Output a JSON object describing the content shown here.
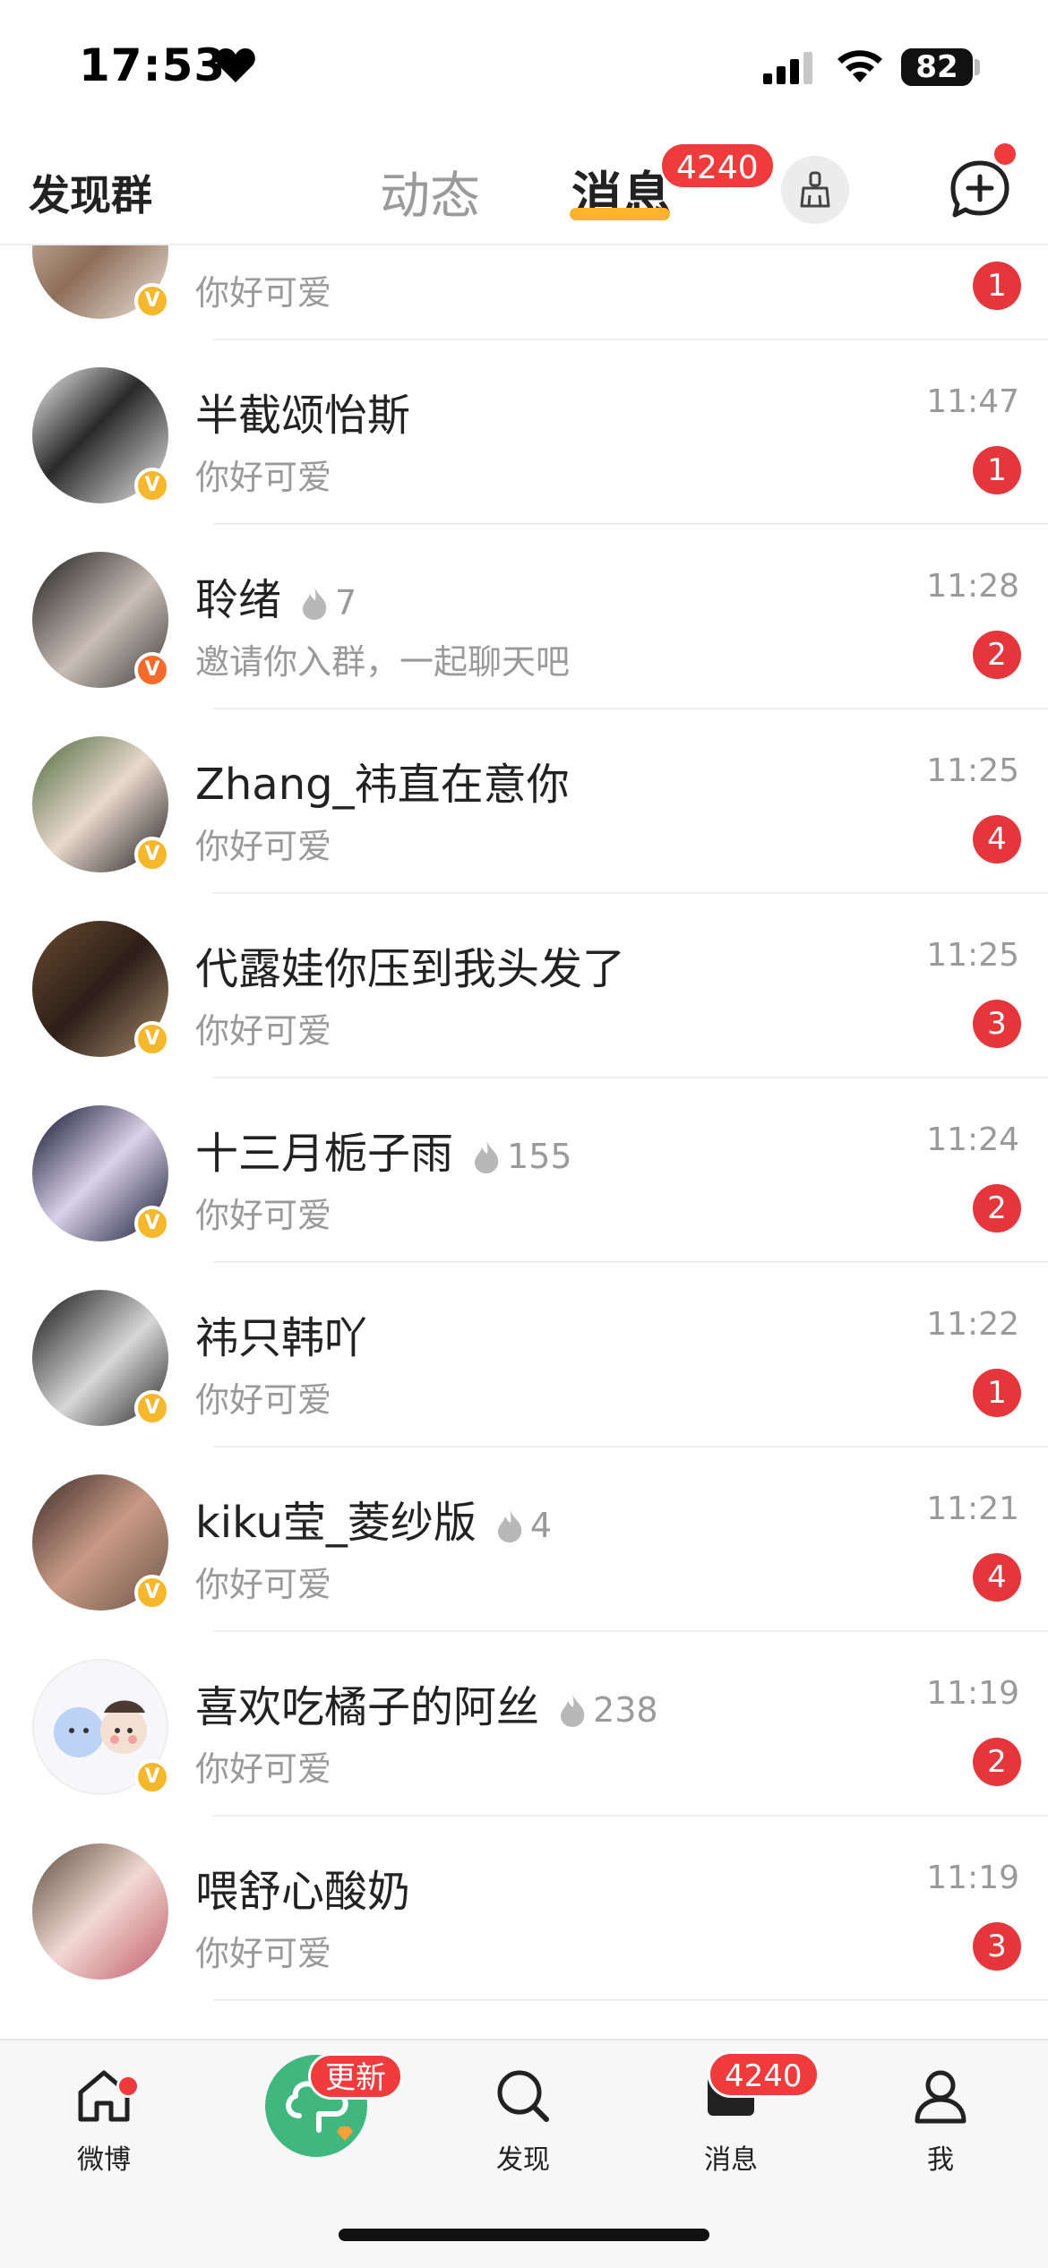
{
  "status_bar": {
    "time": "17:53",
    "battery": "82"
  },
  "header": {
    "discover_group": "发现群",
    "tab_dynamic": "动态",
    "tab_messages": "消息",
    "messages_badge": "4240"
  },
  "colors": {
    "accent_underline": "#ffb22c",
    "badge_red": "#e5373b",
    "verify_yellow": "#f5b72c",
    "verify_orange": "#f26b2a"
  },
  "messages": [
    {
      "name": "",
      "fire": "",
      "preview": "你好可爱",
      "time": "",
      "unread": "1",
      "verify": "yellow"
    },
    {
      "name": "半截颂怡斯",
      "fire": "",
      "preview": "你好可爱",
      "time": "11:47",
      "unread": "1",
      "verify": "yellow"
    },
    {
      "name": "聆绪",
      "fire": "7",
      "preview": "邀请你入群，一起聊天吧",
      "time": "11:28",
      "unread": "2",
      "verify": "orange"
    },
    {
      "name": "Zhang_祎直在意你",
      "fire": "",
      "preview": "你好可爱",
      "time": "11:25",
      "unread": "4",
      "verify": "yellow"
    },
    {
      "name": "代露娃你压到我头发了",
      "fire": "",
      "preview": "你好可爱",
      "time": "11:25",
      "unread": "3",
      "verify": "yellow"
    },
    {
      "name": "十三月栀子雨",
      "fire": "155",
      "preview": "你好可爱",
      "time": "11:24",
      "unread": "2",
      "verify": "yellow"
    },
    {
      "name": "祎只韩吖",
      "fire": "",
      "preview": "你好可爱",
      "time": "11:22",
      "unread": "1",
      "verify": "yellow"
    },
    {
      "name": "kiku莹_菱纱版",
      "fire": "4",
      "preview": "你好可爱",
      "time": "11:21",
      "unread": "4",
      "verify": "yellow"
    },
    {
      "name": "喜欢吃橘子的阿丝",
      "fire": "238",
      "preview": "你好可爱",
      "time": "11:19",
      "unread": "2",
      "verify": "yellow"
    },
    {
      "name": "喂舒心酸奶",
      "fire": "",
      "preview": "你好可爱",
      "time": "11:19",
      "unread": "3",
      "verify": ""
    }
  ],
  "bottom_nav": {
    "home": "微博",
    "update_badge": "更新",
    "discover": "发现",
    "messages": "消息",
    "messages_badge": "4240",
    "me": "我"
  }
}
